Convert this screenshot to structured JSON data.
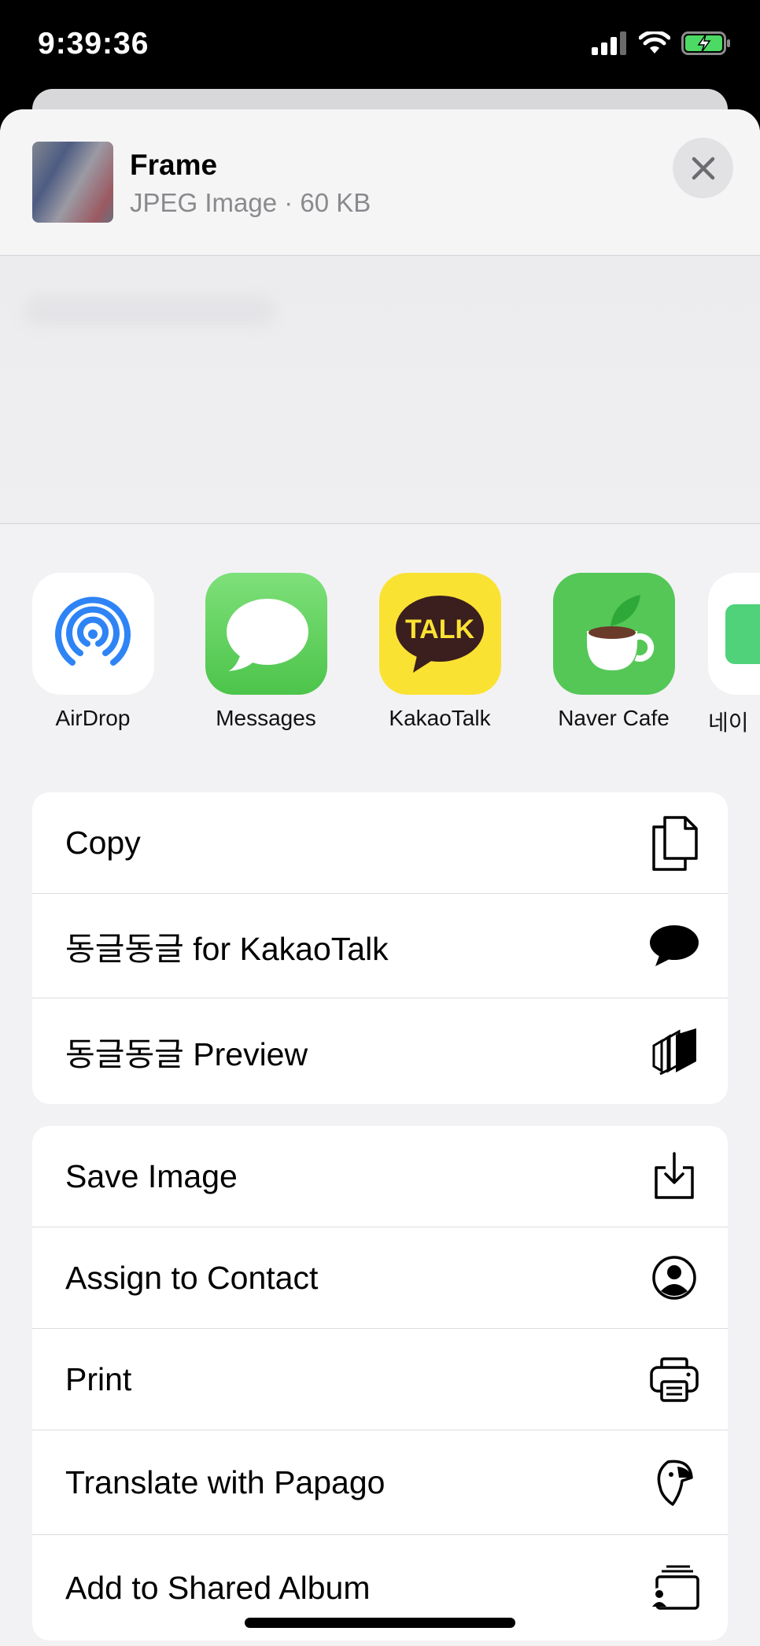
{
  "status": {
    "time": "9:39:36"
  },
  "share": {
    "file_title": "Frame",
    "file_subtitle": "JPEG Image · 60 KB"
  },
  "apps": [
    {
      "label": "AirDrop",
      "icon": "airdrop-icon"
    },
    {
      "label": "Messages",
      "icon": "messages-icon"
    },
    {
      "label": "KakaoTalk",
      "icon": "kakaotalk-icon",
      "badge_text": "TALK"
    },
    {
      "label": "Naver Cafe",
      "icon": "naver-cafe-icon"
    },
    {
      "label": "네이",
      "icon": "naver-icon"
    }
  ],
  "actions_group1": [
    {
      "label": "Copy",
      "icon": "copy-icon"
    },
    {
      "label": "동글동글 for KakaoTalk",
      "icon": "speech-bubble-icon"
    },
    {
      "label": "동글동글 Preview",
      "icon": "preview-cards-icon"
    }
  ],
  "actions_group2": [
    {
      "label": "Save Image",
      "icon": "save-download-icon"
    },
    {
      "label": "Assign to Contact",
      "icon": "contact-icon"
    },
    {
      "label": "Print",
      "icon": "printer-icon"
    },
    {
      "label": "Translate with Papago",
      "icon": "papago-parrot-icon"
    },
    {
      "label": "Add to Shared Album",
      "icon": "shared-album-icon"
    }
  ],
  "colors": {
    "messages_green": "#5fd35a",
    "kakao_yellow": "#fae233",
    "naver_green": "#55c757",
    "airdrop_blue": "#2f84f5"
  }
}
